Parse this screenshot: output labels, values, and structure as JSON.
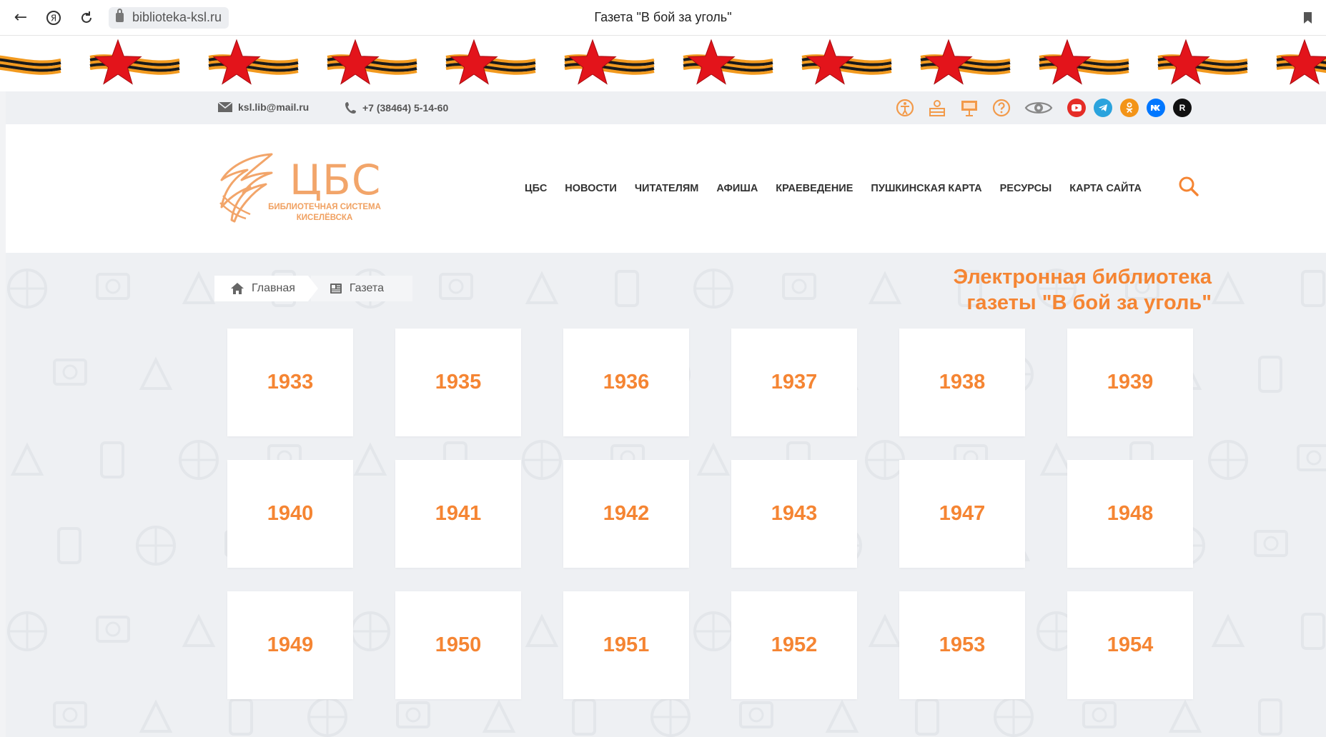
{
  "browser": {
    "url": "biblioteka-ksl.ru",
    "title": "Газета \"В бой за уголь\""
  },
  "contacts": {
    "email": "ksl.lib@mail.ru",
    "phone": "+7 (38464) 5-14-60"
  },
  "social": [
    {
      "name": "youtube",
      "color": "#e52d27"
    },
    {
      "name": "telegram",
      "color": "#2aa3dd"
    },
    {
      "name": "odnoklassniki",
      "color": "#f39418"
    },
    {
      "name": "vk",
      "color": "#0077ff"
    },
    {
      "name": "rutube",
      "color": "#111111",
      "glyph": "R"
    }
  ],
  "logo": {
    "main": "ЦБС",
    "subtitle_line1": "БИБЛИОТЕЧНАЯ СИСТЕМА",
    "subtitle_line2": "КИСЕЛЁВСКА"
  },
  "menu": [
    "ЦБС",
    "НОВОСТИ",
    "ЧИТАТЕЛЯМ",
    "АФИША",
    "КРАЕВЕДЕНИЕ",
    "ПУШКИНСКАЯ КАРТА",
    "РЕСУРСЫ",
    "КАРТА САЙТА"
  ],
  "breadcrumb": {
    "home": "Главная",
    "current": "Газета"
  },
  "library_title": {
    "line1": "Электронная библиотека",
    "line2": "газеты \"В бой за уголь\""
  },
  "years": [
    "1933",
    "1935",
    "1936",
    "1937",
    "1938",
    "1939",
    "1940",
    "1941",
    "1942",
    "1943",
    "1947",
    "1948",
    "1949",
    "1950",
    "1951",
    "1952",
    "1953",
    "1954"
  ],
  "colors": {
    "accent": "#f58533",
    "logo": "#f2a56a",
    "star": "#e3141b",
    "ribbon_orange": "#f29a1f",
    "ribbon_black": "#1a1a1a"
  }
}
